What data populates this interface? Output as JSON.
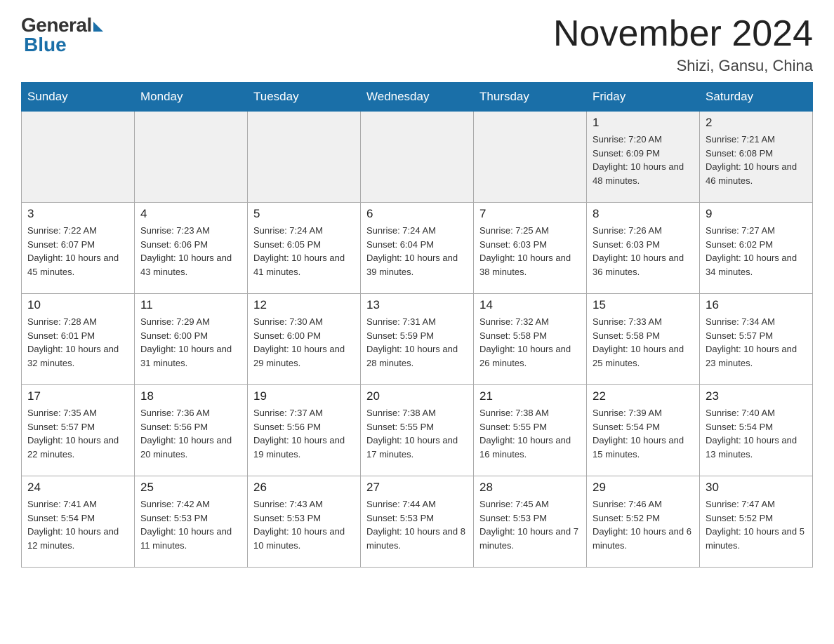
{
  "header": {
    "logo_general": "General",
    "logo_blue": "Blue",
    "title": "November 2024",
    "location": "Shizi, Gansu, China"
  },
  "weekdays": [
    "Sunday",
    "Monday",
    "Tuesday",
    "Wednesday",
    "Thursday",
    "Friday",
    "Saturday"
  ],
  "weeks": [
    [
      {
        "day": "",
        "info": ""
      },
      {
        "day": "",
        "info": ""
      },
      {
        "day": "",
        "info": ""
      },
      {
        "day": "",
        "info": ""
      },
      {
        "day": "",
        "info": ""
      },
      {
        "day": "1",
        "info": "Sunrise: 7:20 AM\nSunset: 6:09 PM\nDaylight: 10 hours and 48 minutes."
      },
      {
        "day": "2",
        "info": "Sunrise: 7:21 AM\nSunset: 6:08 PM\nDaylight: 10 hours and 46 minutes."
      }
    ],
    [
      {
        "day": "3",
        "info": "Sunrise: 7:22 AM\nSunset: 6:07 PM\nDaylight: 10 hours and 45 minutes."
      },
      {
        "day": "4",
        "info": "Sunrise: 7:23 AM\nSunset: 6:06 PM\nDaylight: 10 hours and 43 minutes."
      },
      {
        "day": "5",
        "info": "Sunrise: 7:24 AM\nSunset: 6:05 PM\nDaylight: 10 hours and 41 minutes."
      },
      {
        "day": "6",
        "info": "Sunrise: 7:24 AM\nSunset: 6:04 PM\nDaylight: 10 hours and 39 minutes."
      },
      {
        "day": "7",
        "info": "Sunrise: 7:25 AM\nSunset: 6:03 PM\nDaylight: 10 hours and 38 minutes."
      },
      {
        "day": "8",
        "info": "Sunrise: 7:26 AM\nSunset: 6:03 PM\nDaylight: 10 hours and 36 minutes."
      },
      {
        "day": "9",
        "info": "Sunrise: 7:27 AM\nSunset: 6:02 PM\nDaylight: 10 hours and 34 minutes."
      }
    ],
    [
      {
        "day": "10",
        "info": "Sunrise: 7:28 AM\nSunset: 6:01 PM\nDaylight: 10 hours and 32 minutes."
      },
      {
        "day": "11",
        "info": "Sunrise: 7:29 AM\nSunset: 6:00 PM\nDaylight: 10 hours and 31 minutes."
      },
      {
        "day": "12",
        "info": "Sunrise: 7:30 AM\nSunset: 6:00 PM\nDaylight: 10 hours and 29 minutes."
      },
      {
        "day": "13",
        "info": "Sunrise: 7:31 AM\nSunset: 5:59 PM\nDaylight: 10 hours and 28 minutes."
      },
      {
        "day": "14",
        "info": "Sunrise: 7:32 AM\nSunset: 5:58 PM\nDaylight: 10 hours and 26 minutes."
      },
      {
        "day": "15",
        "info": "Sunrise: 7:33 AM\nSunset: 5:58 PM\nDaylight: 10 hours and 25 minutes."
      },
      {
        "day": "16",
        "info": "Sunrise: 7:34 AM\nSunset: 5:57 PM\nDaylight: 10 hours and 23 minutes."
      }
    ],
    [
      {
        "day": "17",
        "info": "Sunrise: 7:35 AM\nSunset: 5:57 PM\nDaylight: 10 hours and 22 minutes."
      },
      {
        "day": "18",
        "info": "Sunrise: 7:36 AM\nSunset: 5:56 PM\nDaylight: 10 hours and 20 minutes."
      },
      {
        "day": "19",
        "info": "Sunrise: 7:37 AM\nSunset: 5:56 PM\nDaylight: 10 hours and 19 minutes."
      },
      {
        "day": "20",
        "info": "Sunrise: 7:38 AM\nSunset: 5:55 PM\nDaylight: 10 hours and 17 minutes."
      },
      {
        "day": "21",
        "info": "Sunrise: 7:38 AM\nSunset: 5:55 PM\nDaylight: 10 hours and 16 minutes."
      },
      {
        "day": "22",
        "info": "Sunrise: 7:39 AM\nSunset: 5:54 PM\nDaylight: 10 hours and 15 minutes."
      },
      {
        "day": "23",
        "info": "Sunrise: 7:40 AM\nSunset: 5:54 PM\nDaylight: 10 hours and 13 minutes."
      }
    ],
    [
      {
        "day": "24",
        "info": "Sunrise: 7:41 AM\nSunset: 5:54 PM\nDaylight: 10 hours and 12 minutes."
      },
      {
        "day": "25",
        "info": "Sunrise: 7:42 AM\nSunset: 5:53 PM\nDaylight: 10 hours and 11 minutes."
      },
      {
        "day": "26",
        "info": "Sunrise: 7:43 AM\nSunset: 5:53 PM\nDaylight: 10 hours and 10 minutes."
      },
      {
        "day": "27",
        "info": "Sunrise: 7:44 AM\nSunset: 5:53 PM\nDaylight: 10 hours and 8 minutes."
      },
      {
        "day": "28",
        "info": "Sunrise: 7:45 AM\nSunset: 5:53 PM\nDaylight: 10 hours and 7 minutes."
      },
      {
        "day": "29",
        "info": "Sunrise: 7:46 AM\nSunset: 5:52 PM\nDaylight: 10 hours and 6 minutes."
      },
      {
        "day": "30",
        "info": "Sunrise: 7:47 AM\nSunset: 5:52 PM\nDaylight: 10 hours and 5 minutes."
      }
    ]
  ]
}
